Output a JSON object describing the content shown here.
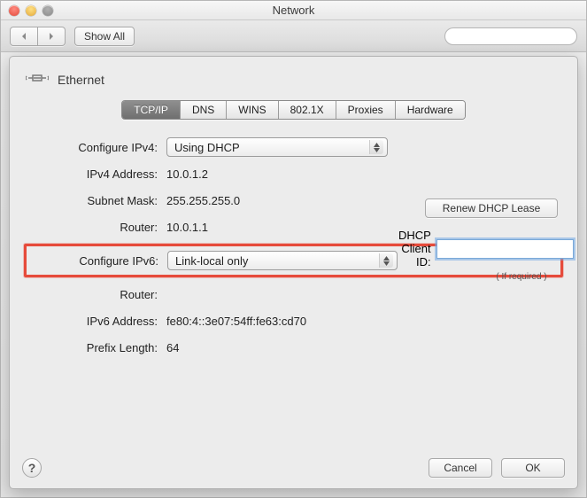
{
  "window": {
    "title": "Network"
  },
  "toolbar": {
    "show_all": "Show All",
    "search_placeholder": ""
  },
  "sheet": {
    "interface": "Ethernet",
    "tabs": [
      "TCP/IP",
      "DNS",
      "WINS",
      "802.1X",
      "Proxies",
      "Hardware"
    ],
    "active_tab": 0
  },
  "ipv4": {
    "configure_label": "Configure IPv4:",
    "configure_value": "Using DHCP",
    "address_label": "IPv4 Address:",
    "address_value": "10.0.1.2",
    "subnet_label": "Subnet Mask:",
    "subnet_value": "255.255.255.0",
    "router_label": "Router:",
    "router_value": "10.0.1.1"
  },
  "dhcp": {
    "renew_label": "Renew DHCP Lease",
    "client_id_label": "DHCP Client ID:",
    "client_id_value": "",
    "if_required": "( If required )"
  },
  "ipv6": {
    "configure_label": "Configure IPv6:",
    "configure_value": "Link-local only",
    "router_label": "Router:",
    "router_value": "",
    "address_label": "IPv6 Address:",
    "address_value": "fe80:4::3e07:54ff:fe63:cd70",
    "prefix_label": "Prefix Length:",
    "prefix_value": "64"
  },
  "footer": {
    "cancel": "Cancel",
    "ok": "OK"
  }
}
